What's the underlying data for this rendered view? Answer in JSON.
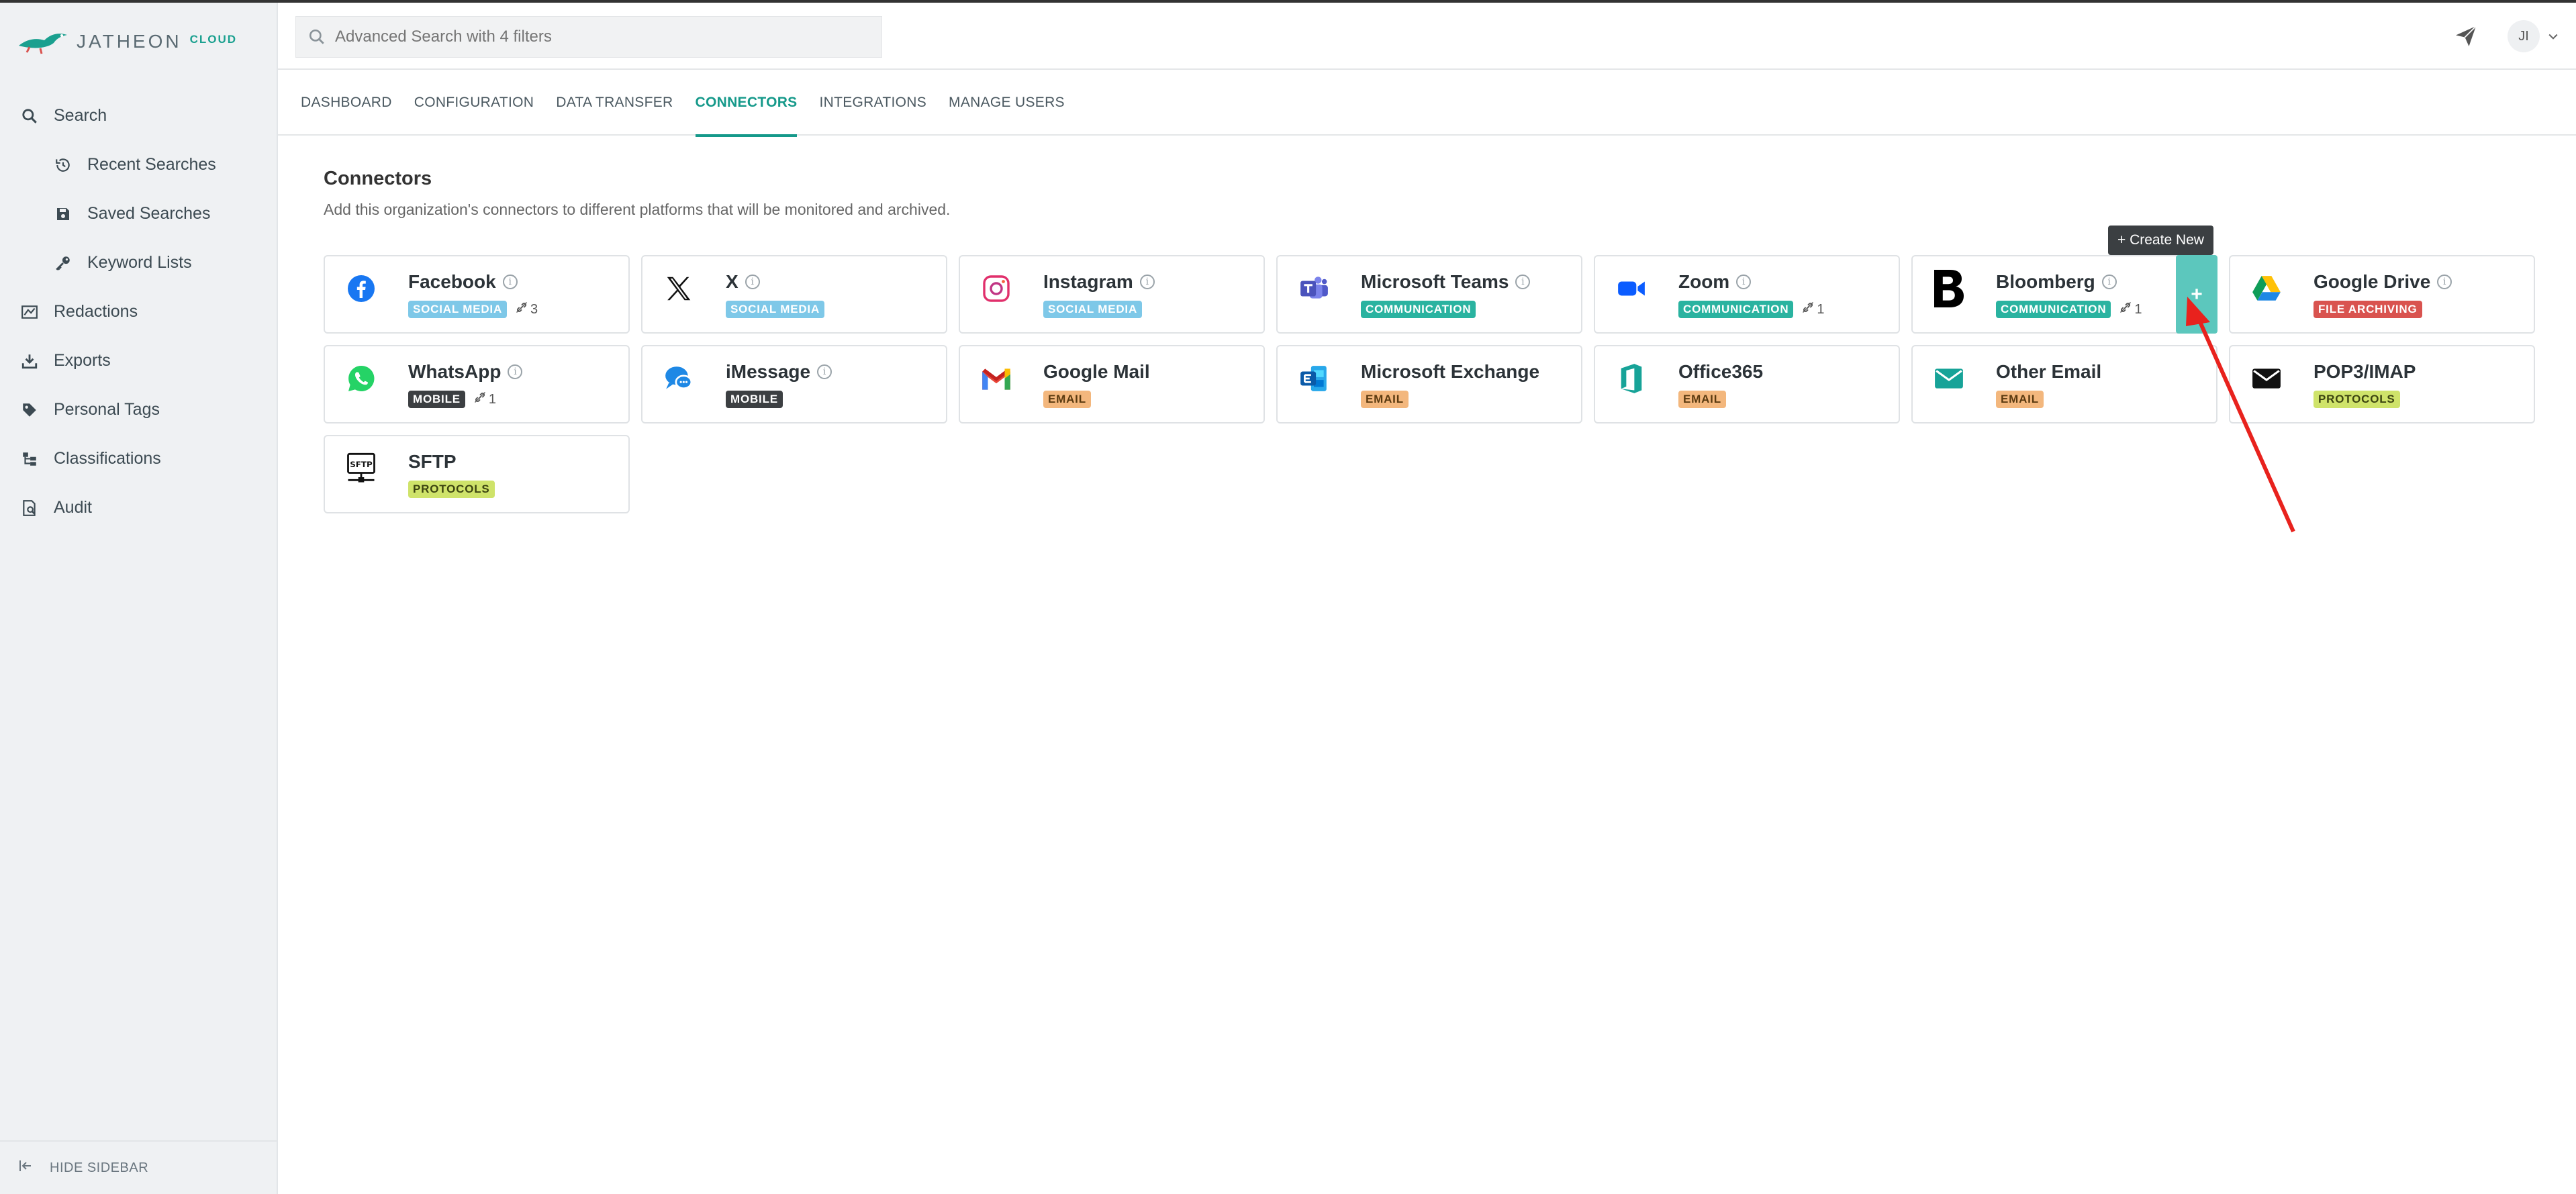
{
  "app": {
    "logo_text": "JATHEON",
    "logo_sub": "CLOUD"
  },
  "search": {
    "placeholder": "Advanced Search with 4 filters"
  },
  "header": {
    "avatar_initials": "JI"
  },
  "sidebar": {
    "items": [
      {
        "label": "Search",
        "icon": "search-icon",
        "sub": false
      },
      {
        "label": "Recent Searches",
        "icon": "history-icon",
        "sub": true
      },
      {
        "label": "Saved Searches",
        "icon": "save-icon",
        "sub": true
      },
      {
        "label": "Keyword Lists",
        "icon": "key-icon",
        "sub": true
      },
      {
        "label": "Redactions",
        "icon": "redaction-icon",
        "sub": false
      },
      {
        "label": "Exports",
        "icon": "download-icon",
        "sub": false
      },
      {
        "label": "Personal Tags",
        "icon": "tag-icon",
        "sub": false
      },
      {
        "label": "Classifications",
        "icon": "classification-icon",
        "sub": false
      },
      {
        "label": "Audit",
        "icon": "audit-icon",
        "sub": false
      }
    ],
    "hide_label": "HIDE SIDEBAR"
  },
  "tabs": [
    {
      "label": "DASHBOARD",
      "active": false
    },
    {
      "label": "CONFIGURATION",
      "active": false
    },
    {
      "label": "DATA TRANSFER",
      "active": false
    },
    {
      "label": "CONNECTORS",
      "active": true
    },
    {
      "label": "INTEGRATIONS",
      "active": false
    },
    {
      "label": "MANAGE USERS",
      "active": false
    }
  ],
  "main": {
    "title": "Connectors",
    "description": "Add this organization's connectors to different platforms that will be monitored and archived.",
    "tooltip": "+ Create New",
    "add_label": "+"
  },
  "connectors": [
    {
      "name": "Facebook",
      "badge": "SOCIAL MEDIA",
      "badge_type": "social",
      "info": true,
      "links": "3",
      "icon": "facebook-icon"
    },
    {
      "name": "X",
      "badge": "SOCIAL MEDIA",
      "badge_type": "social",
      "info": true,
      "links": "",
      "icon": "x-icon"
    },
    {
      "name": "Instagram",
      "badge": "SOCIAL MEDIA",
      "badge_type": "social",
      "info": true,
      "links": "",
      "icon": "instagram-icon"
    },
    {
      "name": "Microsoft Teams",
      "badge": "COMMUNICATION",
      "badge_type": "comm",
      "info": true,
      "links": "",
      "icon": "teams-icon"
    },
    {
      "name": "Zoom",
      "badge": "COMMUNICATION",
      "badge_type": "comm",
      "info": true,
      "links": "1",
      "icon": "zoom-icon"
    },
    {
      "name": "Bloomberg",
      "badge": "COMMUNICATION",
      "badge_type": "comm",
      "info": true,
      "links": "1",
      "icon": "bloomberg-icon",
      "add": true
    },
    {
      "name": "Google Drive",
      "badge": "FILE ARCHIVING",
      "badge_type": "file",
      "info": true,
      "links": "",
      "icon": "google-drive-icon"
    },
    {
      "name": "WhatsApp",
      "badge": "MOBILE",
      "badge_type": "mobile",
      "info": true,
      "links": "1",
      "icon": "whatsapp-icon"
    },
    {
      "name": "iMessage",
      "badge": "MOBILE",
      "badge_type": "mobile",
      "info": true,
      "links": "",
      "icon": "imessage-icon"
    },
    {
      "name": "Google Mail",
      "badge": "EMAIL",
      "badge_type": "email",
      "info": false,
      "links": "",
      "icon": "gmail-icon"
    },
    {
      "name": "Microsoft Exchange",
      "badge": "EMAIL",
      "badge_type": "email",
      "info": false,
      "links": "",
      "icon": "exchange-icon"
    },
    {
      "name": "Office365",
      "badge": "EMAIL",
      "badge_type": "email",
      "info": false,
      "links": "",
      "icon": "office365-icon"
    },
    {
      "name": "Other Email",
      "badge": "EMAIL",
      "badge_type": "email",
      "info": false,
      "links": "",
      "icon": "email-icon"
    },
    {
      "name": "POP3/IMAP",
      "badge": "PROTOCOLS",
      "badge_type": "proto",
      "info": false,
      "links": "",
      "icon": "envelope-icon"
    },
    {
      "name": "SFTP",
      "badge": "PROTOCOLS",
      "badge_type": "proto",
      "info": false,
      "links": "",
      "icon": "sftp-icon"
    }
  ],
  "colors": {
    "accent": "#15998a",
    "add_button": "#5cc7bd",
    "annotation_arrow": "#e8221d"
  }
}
